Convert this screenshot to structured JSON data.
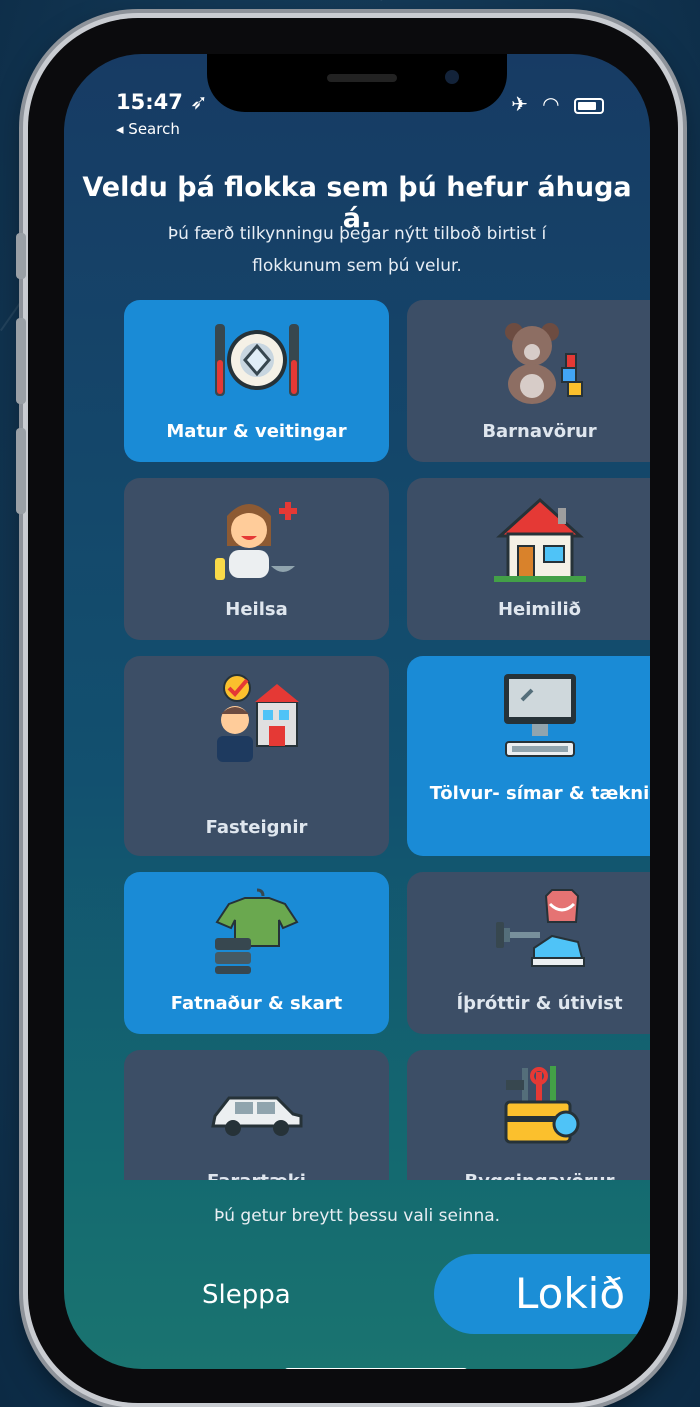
{
  "status_bar": {
    "time": "15:47 ➶",
    "back": "◂ Search",
    "icons": "✈ ◠"
  },
  "heading": "Veldu þá flokka sem þú hefur áhuga á.",
  "subheading": "Þú færð tilkynningu þegar nýtt tilboð birtist í flokkunum sem þú velur.",
  "categories": [
    {
      "label": "Matur & veitingar",
      "selected": true,
      "icon": "plate-cutlery-icon"
    },
    {
      "label": "Barnavörur",
      "selected": false,
      "icon": "teddy-bear-icon"
    },
    {
      "label": "Heilsa",
      "selected": false,
      "icon": "health-person-icon"
    },
    {
      "label": "Heimilið",
      "selected": false,
      "icon": "house-icon"
    },
    {
      "label": "Fasteignir",
      "selected": false,
      "icon": "real-estate-agent-icon"
    },
    {
      "label": "Tölvur- símar & tækni",
      "selected": true,
      "icon": "computer-icon"
    },
    {
      "label": "Fatnaður & skart",
      "selected": true,
      "icon": "clothing-icon"
    },
    {
      "label": "Íþróttir & útivist",
      "selected": false,
      "icon": "sports-gear-icon"
    },
    {
      "label": "Farartæki",
      "selected": false,
      "icon": "car-icon"
    },
    {
      "label": "Byggingavörur",
      "selected": false,
      "icon": "toolbox-icon"
    }
  ],
  "footer_note": "Þú getur breytt þessu vali seinna.",
  "buttons": {
    "skip": "Sleppa",
    "done": "Lokið"
  },
  "colors": {
    "accent": "#1a8bd6",
    "tile": "#3c4e66"
  }
}
